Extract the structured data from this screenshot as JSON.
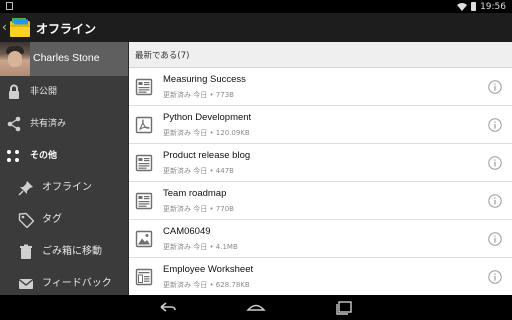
{
  "status_bar": {
    "time": "19:56"
  },
  "action_bar": {
    "title": "オフライン"
  },
  "drawer": {
    "profile_name": "Charles Stone",
    "items": [
      {
        "label": "非公開",
        "icon": "lock-icon"
      },
      {
        "label": "共有済み",
        "icon": "share-icon"
      },
      {
        "label": "その他",
        "icon": "more-icon"
      },
      {
        "label": "オフライン",
        "icon": "pin-icon"
      },
      {
        "label": "タグ",
        "icon": "tag-icon"
      },
      {
        "label": "ごみ箱に移動",
        "icon": "trash-icon"
      },
      {
        "label": "フィードバック",
        "icon": "mail-icon"
      }
    ]
  },
  "main": {
    "section_header": "最新である(7)",
    "files": [
      {
        "name": "Measuring Success",
        "meta": "更新済み 今日 • 773B",
        "icon": "document-icon"
      },
      {
        "name": "Python Development",
        "meta": "更新済み 今日 • 120.09KB",
        "icon": "pdf-icon"
      },
      {
        "name": "Product release blog",
        "meta": "更新済み 今日 • 447B",
        "icon": "document-icon"
      },
      {
        "name": "Team roadmap",
        "meta": "更新済み 今日 • 770B",
        "icon": "document-icon"
      },
      {
        "name": "CAM06049",
        "meta": "更新済み 今日 • 4.1MB",
        "icon": "image-icon"
      },
      {
        "name": "Employee Worksheet",
        "meta": "更新済み 今日 • 628.78KB",
        "icon": "spreadsheet-icon"
      }
    ]
  },
  "colors": {
    "action_bar_bg": "#1d1d1d",
    "drawer_bg": "#3b3b3b",
    "profile_bg": "#5f5f5f",
    "section_header_bg": "#efefef"
  }
}
